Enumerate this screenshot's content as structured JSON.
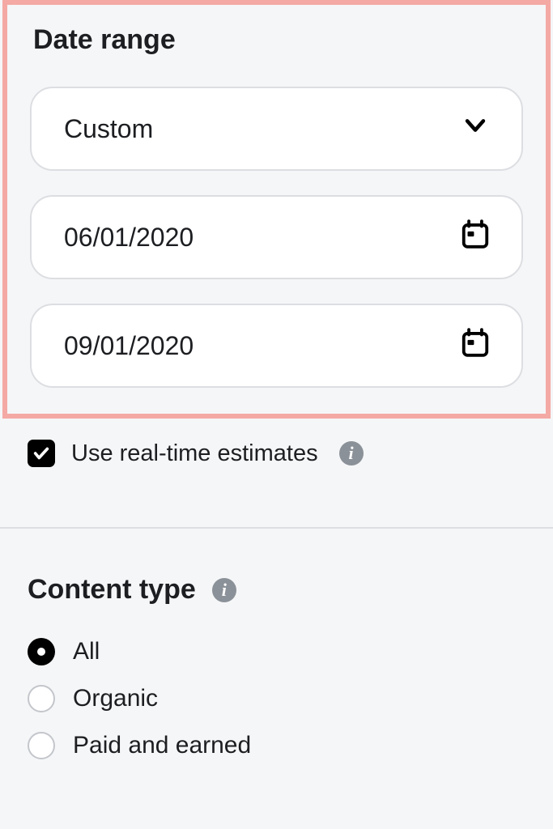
{
  "dateRange": {
    "title": "Date range",
    "preset": "Custom",
    "startDate": "06/01/2020",
    "endDate": "09/01/2020"
  },
  "realtime": {
    "label": "Use real-time estimates",
    "checked": true
  },
  "contentType": {
    "title": "Content type",
    "options": [
      {
        "label": "All",
        "selected": true
      },
      {
        "label": "Organic",
        "selected": false
      },
      {
        "label": "Paid and earned",
        "selected": false
      }
    ]
  }
}
